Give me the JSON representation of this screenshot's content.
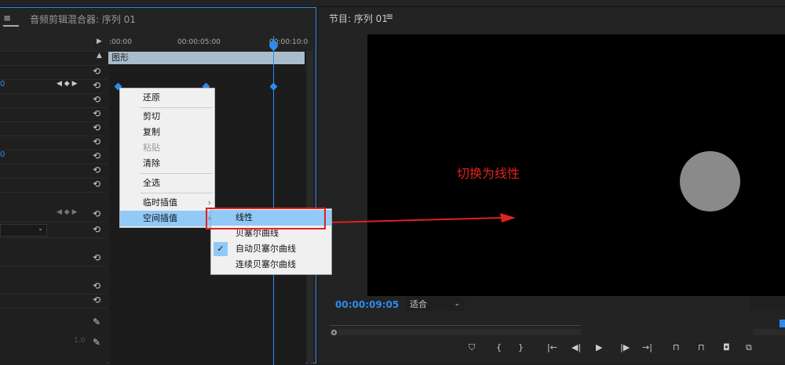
{
  "left_panel": {
    "tab_menu_icon": "hamburger-icon",
    "tab_audio_mixer": "音频剪辑混合器: 序列 01",
    "timeline": {
      "ruler_labels": [
        ":00:00",
        "00:00:05:00",
        "00:00:10:0"
      ],
      "clip_label": "图形"
    },
    "props": {
      "blue_values": [
        "0",
        "0"
      ],
      "opacity_value": "1.0"
    }
  },
  "context_menu": {
    "items": [
      "还原",
      "剪切",
      "复制",
      "粘贴",
      "清除",
      "全选",
      "临时插值",
      "空间插值"
    ],
    "disabled": [
      "粘贴"
    ],
    "highlighted": "空间插值"
  },
  "submenu": {
    "items": [
      "线性",
      "贝塞尔曲线",
      "自动贝塞尔曲线",
      "连续贝塞尔曲线"
    ],
    "highlighted": "线性",
    "checked": "自动贝塞尔曲线"
  },
  "annotation": {
    "text": "切换为线性",
    "color": "#e0221c"
  },
  "program_monitor": {
    "title": "节目: 序列 01",
    "timecode": "00:00:09:05",
    "fit": "适合",
    "controls": [
      "marker-icon",
      "in-point-icon",
      "out-point-icon",
      "go-to-in-icon",
      "step-back-icon",
      "play-icon",
      "step-forward-icon",
      "go-to-out-icon",
      "lift-icon",
      "extract-icon",
      "camera-icon",
      "compare-icon"
    ]
  },
  "colors": {
    "accent": "#2d8ceb",
    "highlight": "#91c9f7"
  }
}
